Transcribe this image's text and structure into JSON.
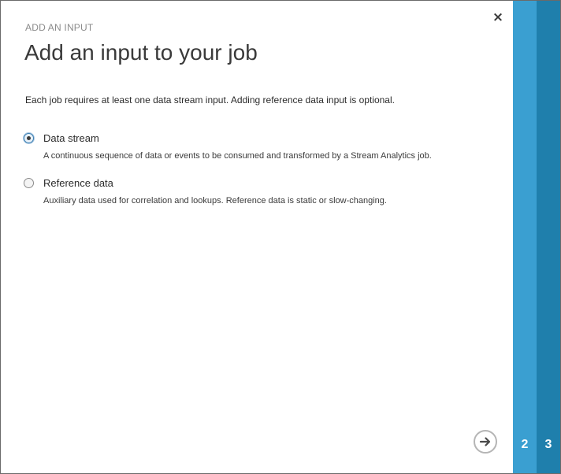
{
  "dialog": {
    "eyebrow": "ADD AN INPUT",
    "title": "Add an input to your job",
    "description": "Each job requires at least one data stream input. Adding reference data input is optional.",
    "close_icon": "close-icon",
    "close_glyph": "×"
  },
  "options": [
    {
      "label": "Data stream",
      "sublabel": "A continuous sequence of data or events to be consumed and transformed by a Stream Analytics job.",
      "selected": true
    },
    {
      "label": "Reference data",
      "sublabel": "Auxiliary data used for correlation and lookups. Reference data is static or slow-changing.",
      "selected": false
    }
  ],
  "footer": {
    "next_icon": "arrow-right-icon"
  },
  "wizard_steps": [
    {
      "number": "2",
      "color": "#3a9fd1"
    },
    {
      "number": "3",
      "color": "#1f7fac"
    }
  ]
}
